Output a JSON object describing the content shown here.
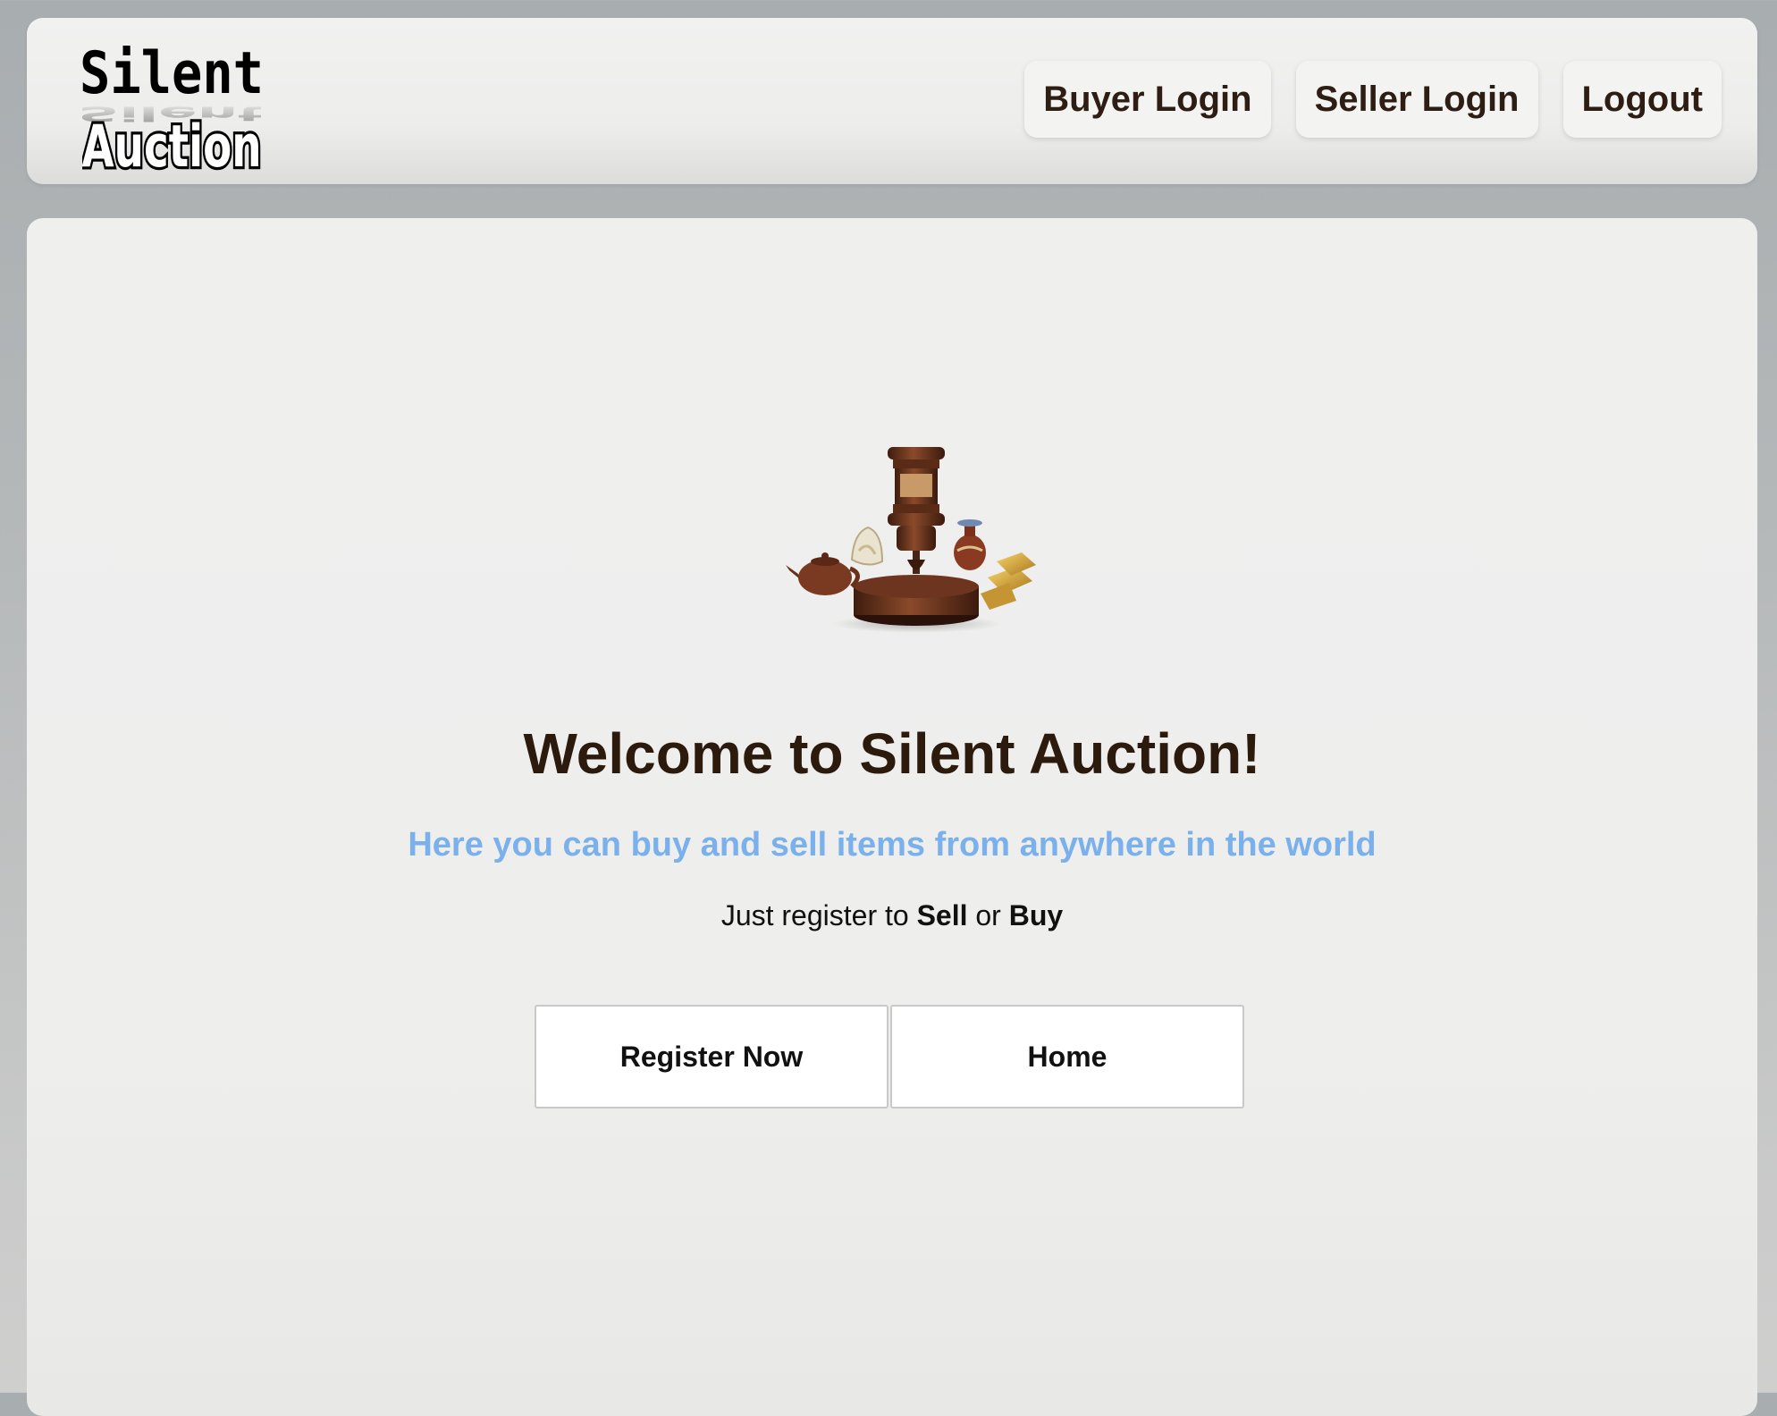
{
  "header": {
    "logo": {
      "line1": "Silent",
      "line2": "Auction"
    },
    "nav": [
      {
        "label": "Buyer Login"
      },
      {
        "label": "Seller Login"
      },
      {
        "label": "Logout"
      }
    ]
  },
  "main": {
    "hero_icon": "gavel-with-antiques-icon",
    "title": "Welcome to Silent Auction!",
    "subtitle": "Here you can buy and sell items from anywhere in the world",
    "tagline": {
      "prefix": "Just register to ",
      "sell": "Sell",
      "middle": " or ",
      "buy": "Buy"
    },
    "actions": {
      "register_label": "Register Now",
      "home_label": "Home"
    }
  },
  "colors": {
    "heading": "#2c1a0d",
    "subtitle": "#7ab0ec",
    "page_background": "#a8adaf",
    "panel_background": "#efefee"
  }
}
